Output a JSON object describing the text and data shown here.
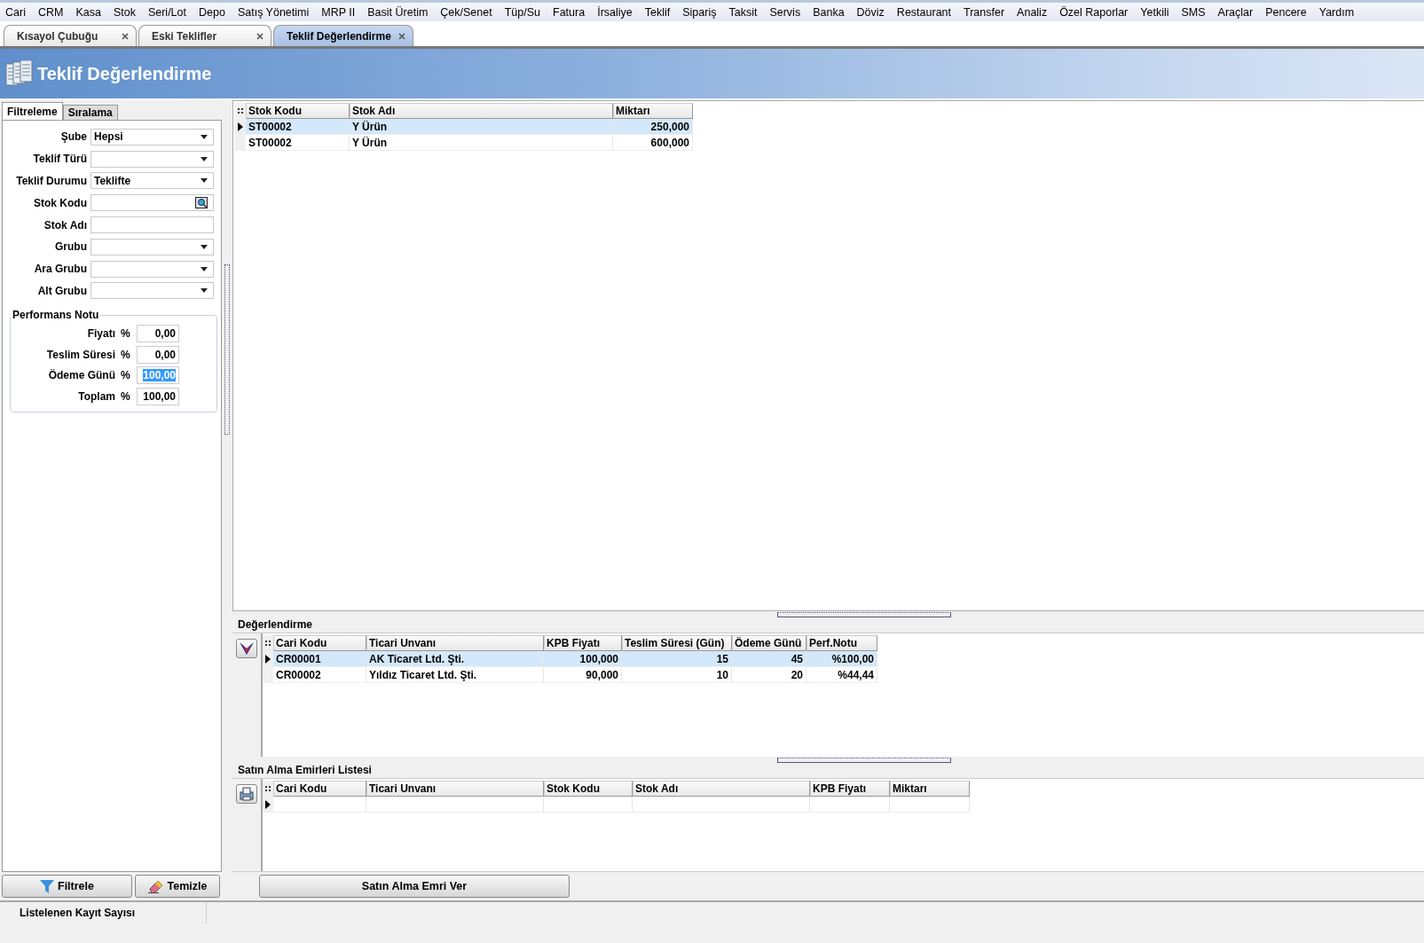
{
  "menu": [
    "Cari",
    "CRM",
    "Kasa",
    "Stok",
    "Seri/Lot",
    "Depo",
    "Satış Yönetimi",
    "MRP II",
    "Basit Üretim",
    "Çek/Senet",
    "Tüp/Su",
    "Fatura",
    "İrsaliye",
    "Teklif",
    "Sipariş",
    "Taksit",
    "Servis",
    "Banka",
    "Döviz",
    "Restaurant",
    "Transfer",
    "Analiz",
    "Özel Raporlar",
    "Yetkili",
    "SMS",
    "Araçlar",
    "Pencere",
    "Yardım"
  ],
  "doc_tabs": [
    {
      "label": "Kısayol Çubuğu",
      "selected": false
    },
    {
      "label": "Eski Teklifler",
      "selected": false
    },
    {
      "label": "Teklif Değerlendirme",
      "selected": true
    }
  ],
  "header": {
    "title": "Teklif Değerlendirme"
  },
  "filter_tabs": [
    {
      "label": "Filtreleme",
      "selected": true
    },
    {
      "label": "Sıralama",
      "selected": false
    }
  ],
  "filter_fields": [
    {
      "label": "Şube",
      "kind": "dropdown",
      "value": "Hepsi"
    },
    {
      "label": "Teklif Türü",
      "kind": "dropdown"
    },
    {
      "label": "Teklif Durumu",
      "kind": "dropdown",
      "value": "Teklifte"
    },
    {
      "label": "Stok Kodu",
      "kind": "lookup"
    },
    {
      "label": "Stok Adı",
      "kind": "text"
    },
    {
      "label": "Grubu",
      "kind": "dropdown"
    },
    {
      "label": "Ara Grubu",
      "kind": "dropdown"
    },
    {
      "label": "Alt Grubu",
      "kind": "dropdown"
    }
  ],
  "performance": {
    "title": "Performans Notu",
    "rows": [
      {
        "label": "Fiyatı",
        "unit": "%",
        "value": "0,00",
        "selected": false
      },
      {
        "label": "Teslim Süresi",
        "unit": "%",
        "value": "0,00",
        "selected": false
      },
      {
        "label": "Ödeme Günü",
        "unit": "%",
        "value": "100,00",
        "selected": true
      },
      {
        "label": "Toplam",
        "unit": "%",
        "value": "100,00",
        "selected": false
      }
    ]
  },
  "filter_buttons": [
    {
      "label": "Filtrele",
      "kind": "filter"
    },
    {
      "label": "Temizle",
      "kind": "clear"
    }
  ],
  "stock_grid": {
    "columns": [
      "Stok Kodu",
      "Stok Adı",
      "Miktarı"
    ],
    "rows": [
      {
        "cells": [
          "ST00002",
          "Y Ürün",
          "250,000"
        ],
        "selected": true
      },
      {
        "cells": [
          "ST00002",
          "Y Ürün",
          "600,000"
        ],
        "selected": false
      }
    ]
  },
  "evaluation": {
    "title": "Değerlendirme",
    "columns": [
      "Cari Kodu",
      "Ticari Unvanı",
      "KPB Fiyatı",
      "Teslim Süresi (Gün)",
      "Ödeme Günü",
      "Perf.Notu"
    ],
    "rows": [
      {
        "cells": [
          "CR00001",
          "AK Ticaret Ltd. Şti.",
          "100,000",
          "15",
          "45",
          "%100,00"
        ],
        "selected": true
      },
      {
        "cells": [
          "CR00002",
          "Yıldız Ticaret Ltd. Şti.",
          "90,000",
          "10",
          "20",
          "%44,44"
        ],
        "selected": false
      }
    ]
  },
  "purchase_orders": {
    "title": "Satın Alma Emirleri Listesi",
    "columns": [
      "Cari Kodu",
      "Ticari Unvanı",
      "Stok Kodu",
      "Stok Adı",
      "KPB Fiyatı",
      "Miktarı"
    ],
    "rows": [
      {
        "selected": true
      }
    ]
  },
  "action_button": "Satın Alma Emri Ver",
  "status_bar": [
    "Listelenen Kayıt Sayısı"
  ]
}
